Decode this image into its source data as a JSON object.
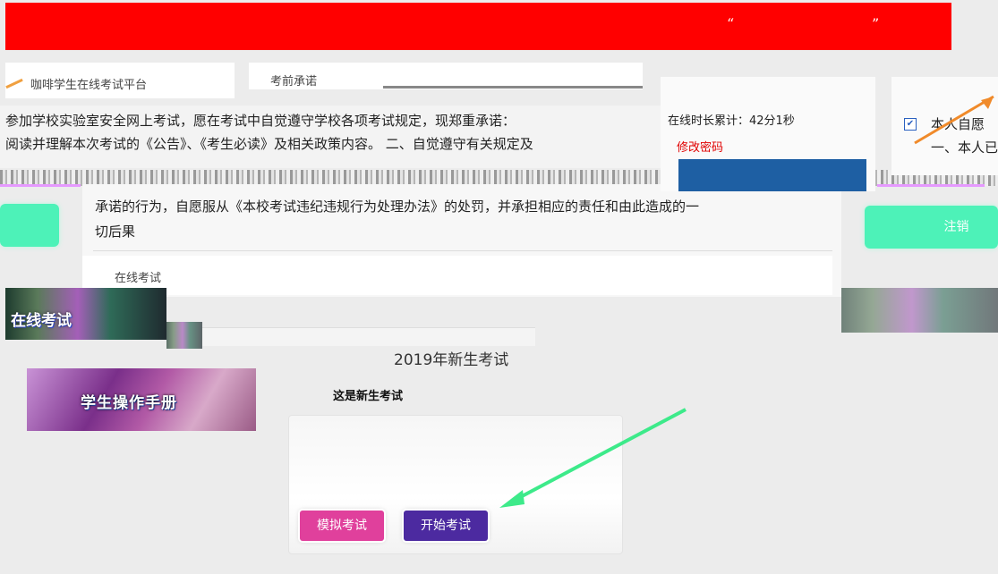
{
  "banner": {
    "left_quote": "“",
    "right_quote": "”"
  },
  "sidebar": {
    "garbled_top": "咖啡学生在线考试平台"
  },
  "notice": {
    "title": "考前承诺",
    "line1": "参加学校实验室安全网上考试，愿在考试中自觉遵守学校各项考试规定，现郑重承诺：",
    "line2": "阅读并理解本次考试的《公告》、《考生必读》及相关政策内容。 二、自觉遵守有关规定及",
    "line3": "承诺的行为，自愿服从《本校考试违纪违规行为处理办法》的处罚，并承担相应的责任和由此造成的一",
    "line4": "切后果",
    "breadcrumb": "在线考试"
  },
  "user": {
    "online_time": "在线时长累计：42分1秒",
    "change_password": "修改密码"
  },
  "agreement": {
    "line1": "本人自愿",
    "line2": "一、本人已阅"
  },
  "buttons": {
    "logout": "注销"
  },
  "left_menu": {
    "online_exam": "在线考试",
    "student_manual": "学生操作手册"
  },
  "exam": {
    "title": "2019年新生考试",
    "description": "这是新生考试",
    "mock_label": "模拟考试",
    "start_label": "开始考试"
  },
  "colors": {
    "banner": "#ff0000",
    "accent_green": "#4df2b8",
    "mock_button": "#e0409c",
    "start_button": "#4c2aa0",
    "link_red": "#e00000"
  }
}
